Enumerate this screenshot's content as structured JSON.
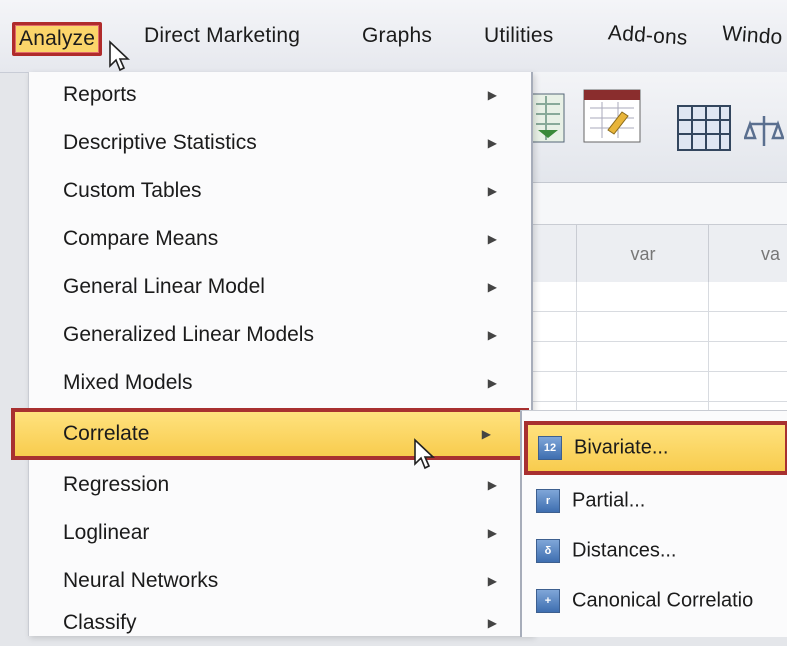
{
  "menubar": {
    "items": [
      {
        "label": "Analyze",
        "mnemonic": "A",
        "active": true
      },
      {
        "label": "Direct Marketing",
        "mnemonic": "M"
      },
      {
        "label": "Graphs",
        "mnemonic": "G"
      },
      {
        "label": "Utilities",
        "mnemonic": "U"
      },
      {
        "label": "Add-ons",
        "mnemonic": "o"
      },
      {
        "label": "Windo",
        "mnemonic": "W"
      }
    ]
  },
  "analyze_menu": {
    "items": [
      {
        "label": "Reports"
      },
      {
        "label": "Descriptive Statistics"
      },
      {
        "label": "Custom Tables"
      },
      {
        "label": "Compare Means"
      },
      {
        "label": "General Linear Model"
      },
      {
        "label": "Generalized Linear Models"
      },
      {
        "label": "Mixed Models"
      },
      {
        "label": "Correlate",
        "highlighted": true
      },
      {
        "label": "Regression"
      },
      {
        "label": "Loglinear"
      },
      {
        "label": "Neural Networks"
      },
      {
        "label": "Classify"
      }
    ]
  },
  "correlate_submenu": {
    "items": [
      {
        "label": "Bivariate...",
        "icon_text": "12",
        "highlighted": true
      },
      {
        "label": "Partial...",
        "icon_text": "r"
      },
      {
        "label": "Distances...",
        "icon_text": "δ"
      },
      {
        "label": "Canonical Correlatio",
        "icon_text": "+"
      }
    ]
  },
  "data_grid": {
    "columns": [
      "var",
      "va"
    ]
  },
  "colors": {
    "highlight": "#f8cc4e",
    "highlight_border": "#a83030",
    "menu_bg": "#fbfbfc"
  }
}
